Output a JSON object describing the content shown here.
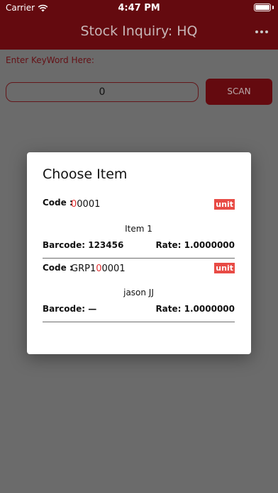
{
  "status_bar": {
    "carrier": "Carrier",
    "time": "4:47 PM"
  },
  "nav": {
    "title": "Stock Inquiry: HQ",
    "more_icon": "more-dots-icon"
  },
  "search": {
    "label": "Enter KeyWord Here:",
    "value": "0",
    "scan_label": "SCAN"
  },
  "dialog": {
    "title": "Choose Item",
    "items": [
      {
        "code_label": "Code :",
        "code_pre": "",
        "code_hl": "0",
        "code_post": "0001",
        "unit": "unit",
        "name": "Item 1",
        "barcode_label": "Barcode:",
        "barcode": "123456",
        "rate_label": "Rate:",
        "rate": "1.0000000"
      },
      {
        "code_label": "Code :",
        "code_pre": "GRP1",
        "code_hl": "0",
        "code_post": "0001",
        "unit": "unit",
        "name": "jason JJ",
        "barcode_label": "Barcode:",
        "barcode": "—",
        "rate_label": "Rate:",
        "rate": "1.0000000"
      }
    ]
  },
  "colors": {
    "brand": "#640a0f",
    "overlay": "#6b6b6b",
    "badge": "#e84b45",
    "highlight": "#e12f2f"
  }
}
